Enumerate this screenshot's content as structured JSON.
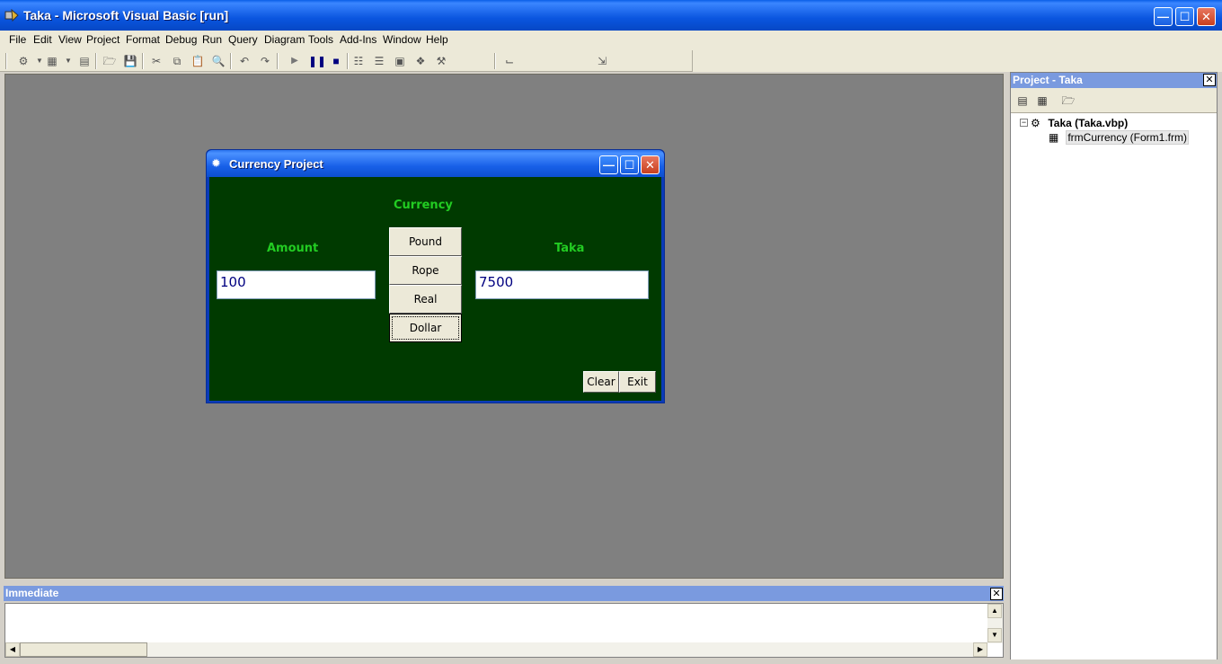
{
  "window": {
    "title": "Taka - Microsoft Visual Basic [run]"
  },
  "menu": {
    "items": [
      "File",
      "Edit",
      "View",
      "Project",
      "Format",
      "Debug",
      "Run",
      "Query",
      "Diagram",
      "Tools",
      "Add-Ins",
      "Window",
      "Help"
    ]
  },
  "form": {
    "title": "Currency Project",
    "currency_label": "Currency",
    "amount_label": "Amount",
    "taka_label": "Taka",
    "amount_value": "100",
    "taka_value": "7500",
    "buttons": {
      "pound": "Pound",
      "rope": "Rope",
      "real": "Real",
      "dollar": "Dollar",
      "clear": "Clear",
      "exit": "Exit"
    },
    "background_color": "#003a00",
    "label_color": "#22cc22"
  },
  "project_panel": {
    "title": "Project - Taka",
    "root": "Taka (Taka.vbp)",
    "child": "frmCurrency (Form1.frm)"
  },
  "immediate": {
    "title": "Immediate"
  }
}
